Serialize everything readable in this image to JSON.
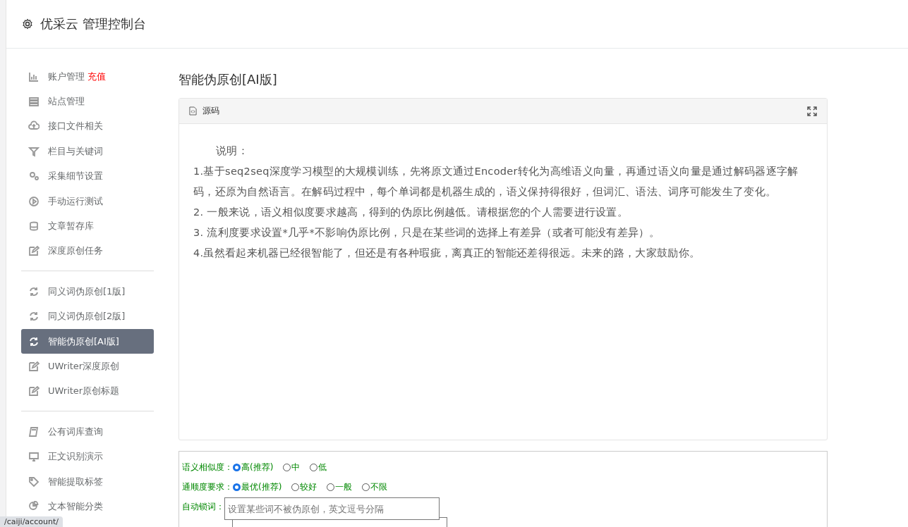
{
  "header": {
    "title": "优采云 管理控制台"
  },
  "sidebar": {
    "groups": [
      {
        "items": [
          {
            "label": "账户管理",
            "badge": "充值",
            "selected": false
          },
          {
            "label": "站点管理",
            "selected": false
          },
          {
            "label": "接口文件相关",
            "selected": false
          },
          {
            "label": "栏目与关键词",
            "selected": false
          },
          {
            "label": "采集细节设置",
            "selected": false
          },
          {
            "label": "手动运行测试",
            "selected": false
          },
          {
            "label": "文章暂存库",
            "selected": false
          },
          {
            "label": "深度原创任务",
            "selected": false
          }
        ]
      },
      {
        "items": [
          {
            "label": "同义词伪原创[1版]",
            "selected": false
          },
          {
            "label": "同义词伪原创[2版]",
            "selected": false
          },
          {
            "label": "智能伪原创[AI版]",
            "selected": true
          },
          {
            "label": "UWriter深度原创",
            "selected": false
          },
          {
            "label": "UWriter原创标题",
            "selected": false
          }
        ]
      },
      {
        "items": [
          {
            "label": "公有词库查询",
            "selected": false
          },
          {
            "label": "正文识别演示",
            "selected": false
          },
          {
            "label": "智能提取标签",
            "selected": false
          },
          {
            "label": "文本智能分类",
            "selected": false
          }
        ]
      }
    ]
  },
  "main": {
    "title": "智能伪原创[AI版]",
    "panel": {
      "tab": "源码",
      "heading": "说明：",
      "lines": [
        "1.基于seq2seq深度学习模型的大规模训练，先将原文通过Encoder转化为高维语义向量，再通过语义向量是通过解码器逐字解码，还原为自然语言。在解码过程中，每个单词都是机器生成的，语义保持得很好，但词汇、语法、词序可能发生了变化。",
        "2. 一般来说，语义相似度要求越高，得到的伪原比例越低。请根据您的个人需要进行设置。",
        "3. 流利度要求设置*几乎*不影响伪原比例，只是在某些词的选择上有差异（或者可能没有差异）。",
        "4.虽然看起来机器已经很智能了，但还是有各种瑕疵，离真正的智能还差得很远。未来的路，大家鼓励你。"
      ]
    },
    "form": {
      "radio_groups": [
        {
          "label": "语义相似度：",
          "options": [
            {
              "label": "高(推荐)",
              "selected": true
            },
            {
              "label": "中",
              "selected": false
            },
            {
              "label": "低",
              "selected": false
            }
          ]
        },
        {
          "label": "通顺度要求：",
          "options": [
            {
              "label": "最优(推荐)",
              "selected": true
            },
            {
              "label": "较好",
              "selected": false
            },
            {
              "label": "一般",
              "selected": false
            },
            {
              "label": "不限",
              "selected": false
            }
          ]
        }
      ],
      "lock_words": {
        "label": "自动锁词：",
        "placeholder": "设置某些词不被伪原创，英文逗号分隔"
      }
    }
  },
  "status_url": "/caiji/account/"
}
